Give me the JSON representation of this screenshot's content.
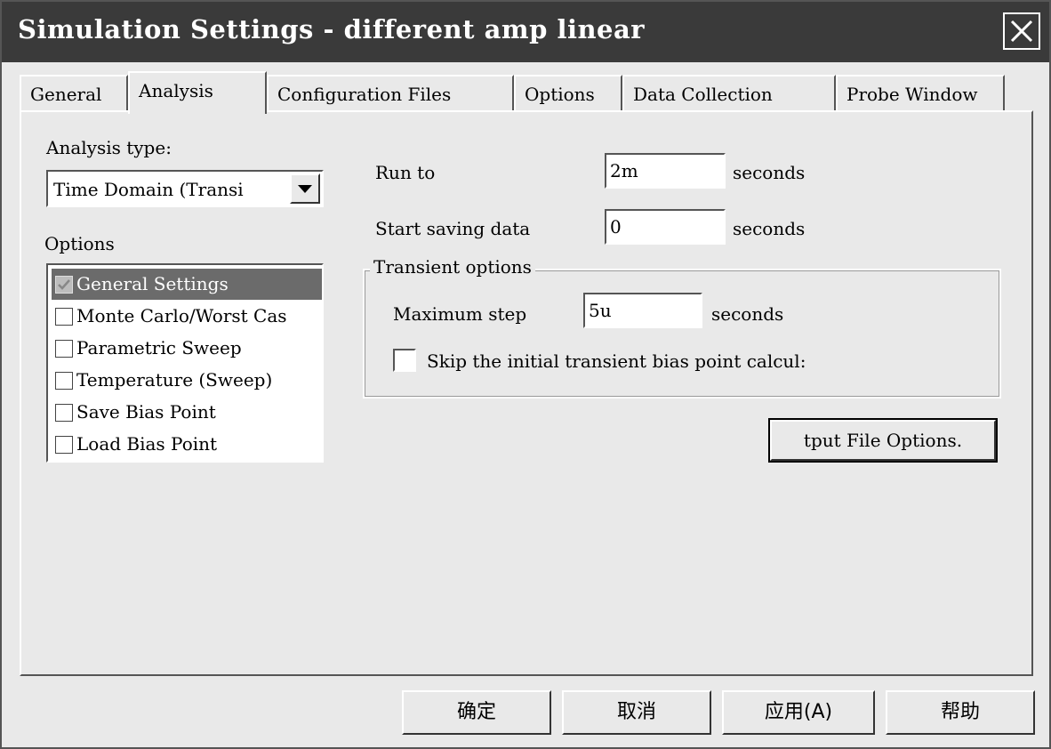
{
  "window": {
    "title": "Simulation Settings - different amp linear",
    "close_icon": "close-icon"
  },
  "tabs": [
    {
      "label": "General"
    },
    {
      "label": "Analysis"
    },
    {
      "label": "Configuration Files"
    },
    {
      "label": "Options"
    },
    {
      "label": "Data Collection"
    },
    {
      "label": "Probe Window"
    }
  ],
  "analysis": {
    "type_label": "Analysis type:",
    "type_value": "Time Domain (Transi",
    "dropdown_icon": "chevron-down-icon",
    "options_label": "Options",
    "options": [
      {
        "label": "General Settings",
        "checked": true,
        "selected": true
      },
      {
        "label": "Monte Carlo/Worst Cas",
        "checked": false,
        "selected": false
      },
      {
        "label": "Parametric Sweep",
        "checked": false,
        "selected": false
      },
      {
        "label": "Temperature (Sweep)",
        "checked": false,
        "selected": false
      },
      {
        "label": "Save Bias Point",
        "checked": false,
        "selected": false
      },
      {
        "label": "Load Bias Point",
        "checked": false,
        "selected": false
      }
    ]
  },
  "settings": {
    "run_to_label": "Run to",
    "run_to_value": "2m",
    "run_to_unit": "seconds",
    "start_saving_label": "Start saving data",
    "start_saving_value": "0",
    "start_saving_unit": "seconds",
    "transient_title": "Transient options",
    "max_step_label": "Maximum step",
    "max_step_value": "5u",
    "max_step_unit": "seconds",
    "skip_bias_label": "Skip the initial transient bias point calcul:",
    "skip_bias_checked": false,
    "output_file_button": "tput File Options."
  },
  "footer": {
    "ok": "确定",
    "cancel": "取消",
    "apply": "应用(A)",
    "help": "帮助"
  }
}
